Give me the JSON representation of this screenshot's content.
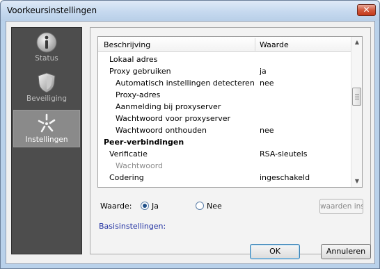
{
  "window": {
    "title": "Voorkeursinstellingen",
    "close_label": "✕"
  },
  "sidebar": {
    "items": [
      {
        "label": "Status",
        "icon": "info-icon",
        "active": false
      },
      {
        "label": "Beveiliging",
        "icon": "shield-icon",
        "active": false
      },
      {
        "label": "Instellingen",
        "icon": "settings-icon",
        "active": true
      }
    ]
  },
  "table": {
    "headers": {
      "name": "Beschrijving",
      "value": "Waarde"
    },
    "rows": [
      {
        "name": "Lokaal adres",
        "value": ""
      },
      {
        "name": "Proxy gebruiken",
        "value": "ja"
      },
      {
        "name": "Automatisch instellingen detecteren",
        "value": "nee"
      },
      {
        "name": "Proxy-adres",
        "value": ""
      },
      {
        "name": "Aanmelding bij proxyserver",
        "value": ""
      },
      {
        "name": "Wachtwoord voor proxyserver",
        "value": ""
      },
      {
        "name": "Wachtwoord onthouden",
        "value": "nee"
      },
      {
        "name": "Peer-verbindingen",
        "value": ""
      },
      {
        "name": "Verificatie",
        "value": "RSA-sleutels"
      },
      {
        "name": "Wachtwoord",
        "value": ""
      },
      {
        "name": "Codering",
        "value": "ingeschakeld"
      }
    ]
  },
  "value_editor": {
    "label": "Waarde:",
    "option_yes": "Ja",
    "option_no": "Nee",
    "selected": "Ja",
    "apply_label": "waarden ins"
  },
  "basic_settings_link": "Basisinstellingen:",
  "footer": {
    "ok_label": "OK",
    "cancel_label": "Annuleren"
  }
}
